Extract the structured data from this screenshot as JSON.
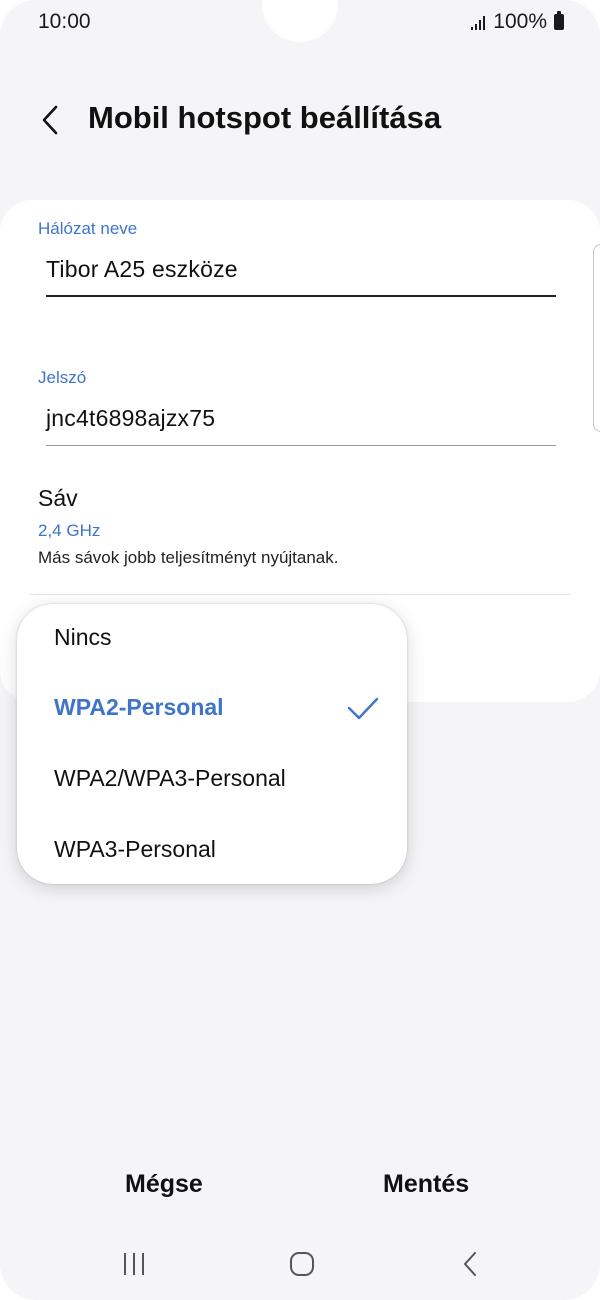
{
  "status_bar": {
    "time": "10:00",
    "battery": "100%",
    "signal_icon": "signal-icon",
    "battery_icon": "battery-icon"
  },
  "header": {
    "back_icon": "chevron-left-icon",
    "title": "Mobil hotspot beállítása"
  },
  "form": {
    "network_name": {
      "label": "Hálózat neve",
      "value": "Tibor A25 eszköze"
    },
    "password": {
      "label": "Jelszó",
      "value": "jnc4t6898ajzx75"
    },
    "band": {
      "title": "Sáv",
      "value": "2,4 GHz",
      "hint": "Más sávok jobb teljesítményt nyújtanak."
    }
  },
  "security_popup": {
    "options": [
      {
        "label": "Nincs",
        "selected": false
      },
      {
        "label": "WPA2-Personal",
        "selected": true
      },
      {
        "label": "WPA2/WPA3-Personal",
        "selected": false
      },
      {
        "label": "WPA3-Personal",
        "selected": false
      }
    ],
    "check_icon": "checkmark-icon"
  },
  "actions": {
    "cancel_label": "Mégse",
    "save_label": "Mentés"
  },
  "nav_bar": {
    "recents_icon": "recent-apps-icon",
    "home_icon": "home-icon",
    "back_icon": "back-icon"
  },
  "colors": {
    "accent": "#3e74c9",
    "background": "#f5f5f7",
    "card": "#ffffff"
  }
}
